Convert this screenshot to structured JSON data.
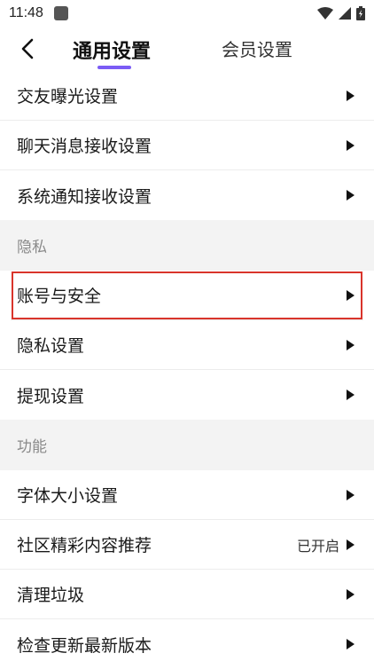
{
  "status_bar": {
    "time": "11:48",
    "icons": [
      "app-icon",
      "wifi-icon",
      "signal-icon",
      "battery-icon"
    ]
  },
  "header": {
    "back_icon": "chevron-left-icon",
    "tabs": [
      {
        "label": "通用设置",
        "active": true
      },
      {
        "label": "会员设置",
        "active": false
      }
    ],
    "accent_color": "#7b5cf5"
  },
  "groups": [
    {
      "items": [
        {
          "label": "交友曝光设置"
        },
        {
          "label": "聊天消息接收设置"
        },
        {
          "label": "系统通知接收设置"
        }
      ]
    },
    {
      "title": "隐私",
      "items": [
        {
          "label": "账号与安全",
          "highlighted": true
        },
        {
          "label": "隐私设置"
        },
        {
          "label": "提现设置"
        }
      ]
    },
    {
      "title": "功能",
      "items": [
        {
          "label": "字体大小设置"
        },
        {
          "label": "社区精彩内容推荐",
          "value": "已开启"
        },
        {
          "label": "清理垃圾"
        },
        {
          "label": "检查更新最新版本"
        }
      ]
    }
  ],
  "highlight_color": "#d9342b"
}
